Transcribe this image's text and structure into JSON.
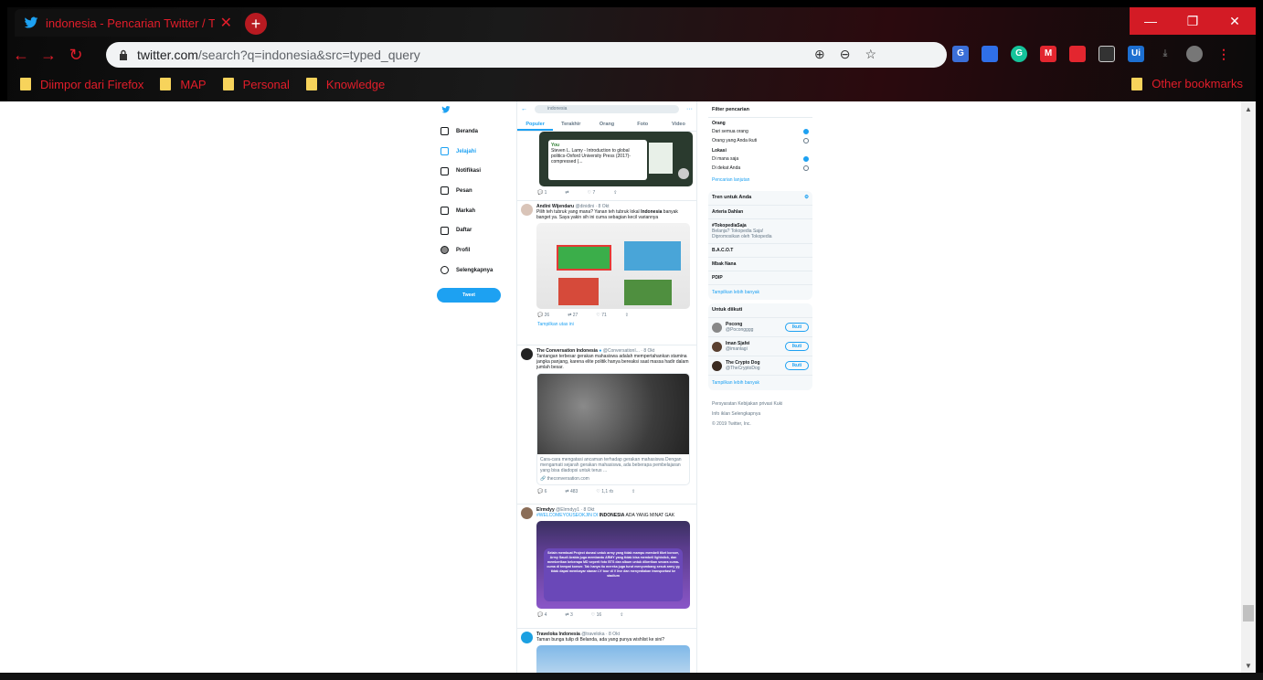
{
  "browser": {
    "tab_title": "indonesia - Pencarian Twitter / T",
    "url_host": "twitter.com",
    "url_path": "/search?q=indonesia&src=typed_query",
    "bookmarks": [
      "Diimpor dari Firefox",
      "MAP",
      "Personal",
      "Knowledge"
    ],
    "other_bookmarks": "Other bookmarks",
    "extensions": [
      "G",
      "",
      "G",
      "M",
      "",
      "",
      "Ui"
    ]
  },
  "nav": {
    "items": [
      "Beranda",
      "Jelajahi",
      "Notifikasi",
      "Pesan",
      "Markah",
      "Daftar",
      "Profil",
      "Selengkapnya"
    ],
    "tweet_button": "Tweet"
  },
  "search": {
    "query": "indonesia",
    "tabs": [
      "Populer",
      "Terakhir",
      "Orang",
      "Foto",
      "Video"
    ]
  },
  "tweets": [
    {
      "card_title": "You",
      "card_text": "Steven L. Lamy - Introduction to global politics-Oxford University Press (2017)-compressed (...",
      "replies": "1",
      "retweets": "",
      "likes": "7"
    },
    {
      "name": "Andini Wijendaru",
      "handle": "@dinidini · 8 Okt",
      "text_1": "Pilih teh tubruk yang mana? Yanan teh tubruk lokal",
      "text_bold": "Indonesia",
      "text_2": "banyak banget ya. Saya yakin sih ini cuma sebagian kecil variannya",
      "replies": "26",
      "retweets": "27",
      "likes": "71",
      "show_thread": "Tampilkan utas ini"
    },
    {
      "name": "The Conversation Indonesia",
      "handle": "@ConversationI... · 8 Okt",
      "text": "Tantangan terbesar gerakan mahasiswa adalah mempertahankan stamina jangka panjang, karena elite politik hanya bereaksi saat massa hadir dalam jumlah besar.",
      "link_text": "Cara-cara mengatasi ancaman terhadap gerakan mahasiswa Dengan mengamati sejarah gerakan mahasiswa, ada beberapa pembelajaran yang bisa diadopsi untuk terus ...",
      "link_domain": "theconversation.com",
      "replies": "6",
      "retweets": "483",
      "likes": "1,1 rb"
    },
    {
      "name": "Elrmdyy",
      "handle": "@Elrmdyy1 · 8 Okt",
      "text_1": "#WELCOMEYOUSEOKJIN DI",
      "text_bold": "INDONESIA",
      "text_2": "ADA YANG MINAT GAK",
      "image_text": "Selain membuat Project donasi untuk army yang tidak mampu membeli tiket konser, Army Saudi Arabia juga membantu ARMY yang tidak bisa membeli lightstick, dan memberikan beberapa MD seperti foto BTS dan album untuk diberikan secara cuma-cuma di tempat konser. Tak hanya itu mereka juga turut menyumbang sesuk army yg tidak dapat membayar stanan LY tour di V live dan menyediakan transportasi ke stadium",
      "replies": "4",
      "retweets": "3",
      "likes": "16"
    },
    {
      "name": "Traveloka Indonesia",
      "handle": "@traveloka · 8 Okt",
      "text": "Taman bunga tulip di Belanda, ada yang punya wishlist ke sini?"
    }
  ],
  "filters": {
    "title": "Filter pencarian",
    "people_label": "Orang",
    "people_options": [
      "Dari semua orang",
      "Orang yang Anda ikuti"
    ],
    "location_label": "Lokasi",
    "location_options": [
      "Di mana saja",
      "Di dekat Anda"
    ],
    "advanced": "Pencarian lanjutan"
  },
  "trends": {
    "title": "Tren untuk Anda",
    "items": [
      {
        "name": "Arteria Dahlan",
        "sub": ""
      },
      {
        "name": "#TokopediaSaja",
        "sub": "Belanja? Tokopedia Saja!",
        "promo": "Dipromosikan oleh Tokopedia"
      },
      {
        "name": "B.A.C.O.T",
        "sub": ""
      },
      {
        "name": "Mbak Nana",
        "sub": ""
      },
      {
        "name": "PDIP",
        "sub": ""
      }
    ],
    "more": "Tampilkan lebih banyak"
  },
  "who_to_follow": {
    "title": "Untuk diikuti",
    "items": [
      {
        "name": "Pocong",
        "handle": "@Pocongggg"
      },
      {
        "name": "Iman Sjafei",
        "handle": "@imanlagi"
      },
      {
        "name": "The Crypto Dog",
        "handle": "@TheCryptoDog"
      }
    ],
    "follow_label": "Ikuti",
    "more": "Tampilkan lebih banyak"
  },
  "footer": {
    "links": "Persyaratan   Kebijakan privasi   Kuki",
    "links2": "Info iklan   Selengkapnya",
    "copyright": "© 2019 Twitter, Inc."
  }
}
